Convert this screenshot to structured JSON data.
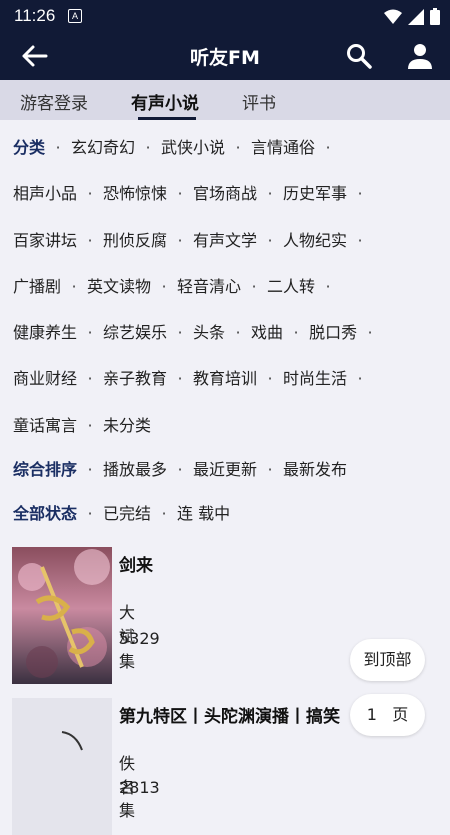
{
  "status": {
    "time": "11:26",
    "notif_letter": "A"
  },
  "header": {
    "title": "听友FM"
  },
  "tabs": [
    {
      "label": "游客登录"
    },
    {
      "label": "有声小说"
    },
    {
      "label": "评书"
    }
  ],
  "filters": {
    "category_label": "分类",
    "rows": [
      [
        "玄幻奇幻",
        "武侠小说",
        "言情通俗"
      ],
      [
        "相声小品",
        "恐怖惊悚",
        "官场商战",
        "历史军事"
      ],
      [
        "百家讲坛",
        "刑侦反腐",
        "有声文学",
        "人物纪实"
      ],
      [
        "广播剧",
        "英文读物",
        "轻音清心",
        "二人转"
      ],
      [
        "健康养生",
        "综艺娱乐",
        "头条",
        "戏曲",
        "脱口秀"
      ],
      [
        "商业财经",
        "亲子教育",
        "教育培训",
        "时尚生活"
      ],
      [
        "童话寓言",
        "未分类"
      ]
    ],
    "sort_label": "综合排序",
    "sort_options": [
      "播放最多",
      "最近更新",
      "最新发布"
    ],
    "state_label": "全部状态",
    "state_options": [
      "已完结",
      "连 载中"
    ]
  },
  "books": [
    {
      "title": "剑来",
      "author": "大斌",
      "count": "5329集"
    },
    {
      "title": "第九特区丨头陀渊演播丨搞笑",
      "author": "佚名",
      "count": "2813集"
    }
  ],
  "floating": {
    "top_label": "到顶部",
    "page_number": "1",
    "page_unit": "页"
  },
  "colors": {
    "header_bg": "#111a36",
    "tab_bg": "#d9d9e6",
    "page_bg": "#f1f1f7",
    "accent": "#1a2e63"
  }
}
